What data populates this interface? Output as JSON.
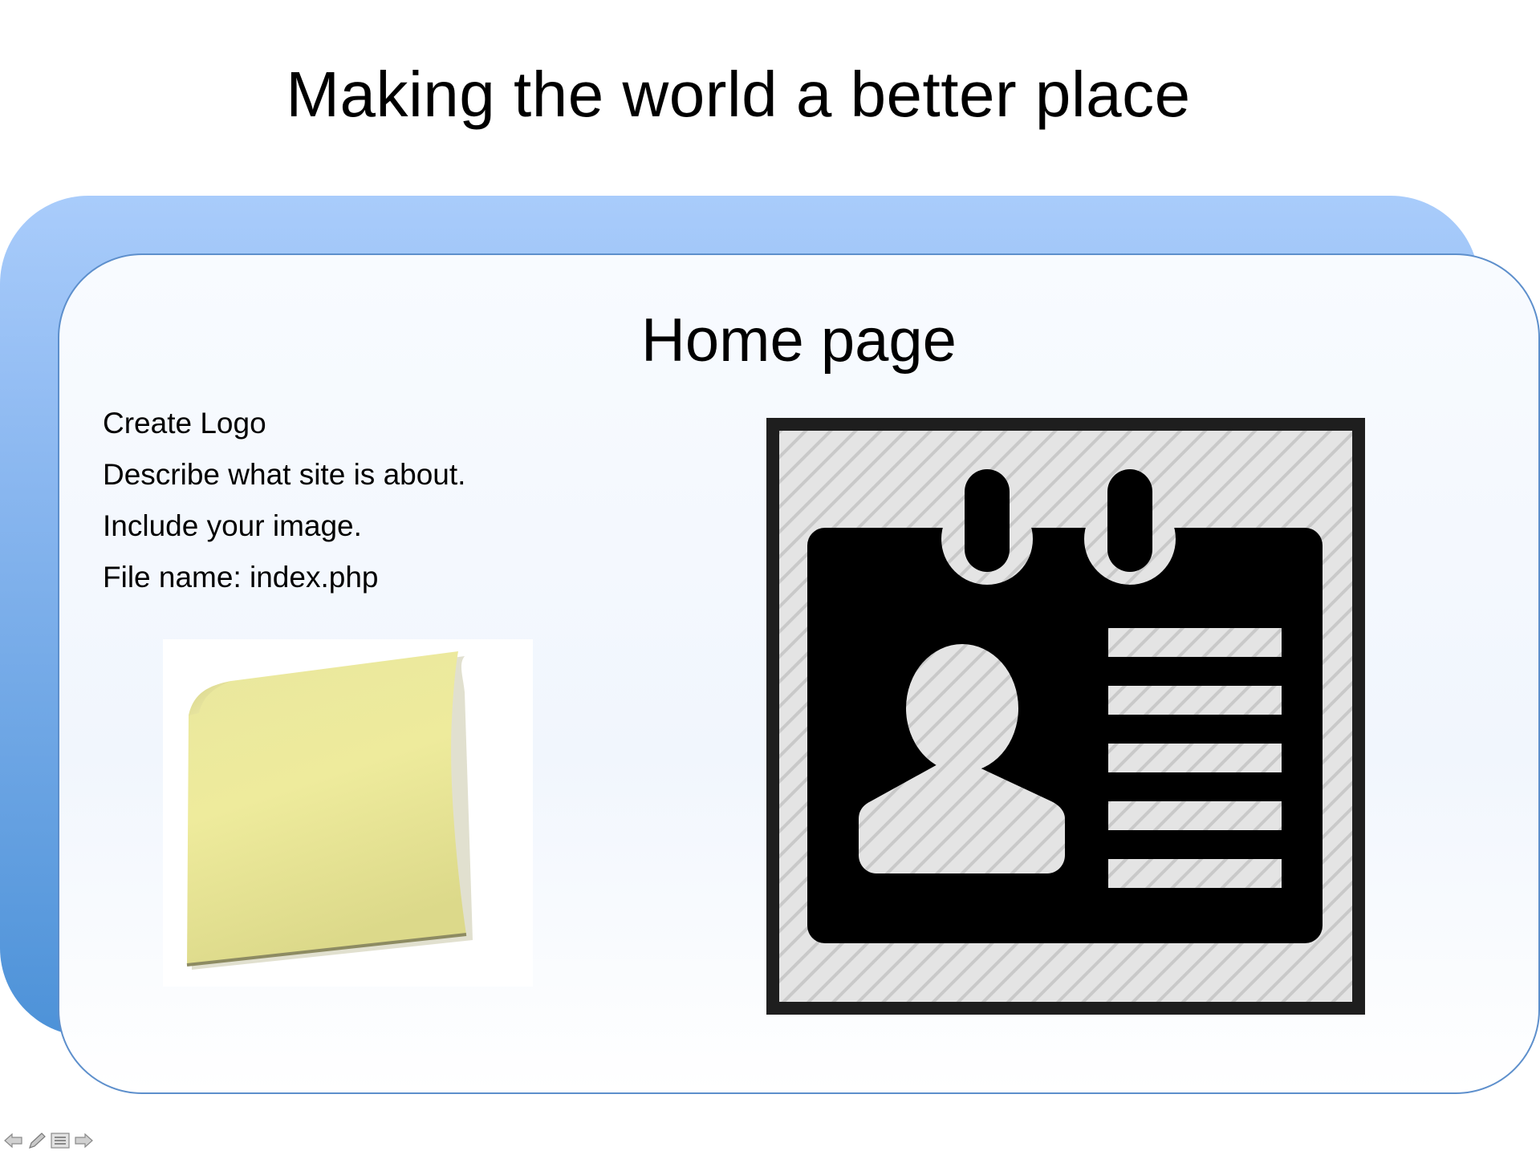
{
  "slide": {
    "title": "Making the world a better place",
    "panel_title": "Home page",
    "bullets": [
      "Create Logo",
      "Describe what site is about.",
      "Include your image.",
      "File name: index.php"
    ]
  },
  "images": {
    "left": "sticky-note-icon",
    "right": "id-badge-icon"
  },
  "nav": {
    "icons": [
      "previous-arrow-icon",
      "pen-icon",
      "menu-icon",
      "next-arrow-icon"
    ]
  },
  "colors": {
    "back_shape_top": "#a9ccfb",
    "back_shape_bottom": "#4d92d8",
    "panel_border": "#5d8fcc",
    "sticky_note": "#ece99c",
    "badge": "#000000",
    "badge_stripes": "#e2e2e2"
  }
}
